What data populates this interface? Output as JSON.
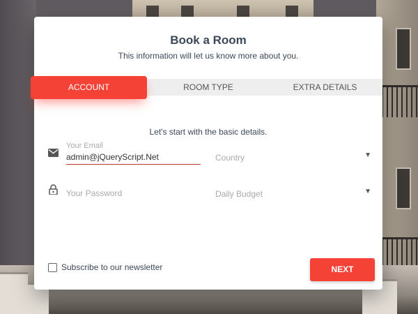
{
  "card": {
    "title": "Book a Room",
    "subtitle": "This information will let us know more about you.",
    "info": "Let's start with the basic details."
  },
  "tabs": [
    {
      "label": "ACCOUNT",
      "active": true
    },
    {
      "label": "ROOM TYPE",
      "active": false
    },
    {
      "label": "EXTRA DETAILS",
      "active": false
    }
  ],
  "form": {
    "email": {
      "label": "Your Email",
      "value": "admin@jQueryScript.Net",
      "icon": "envelope-icon"
    },
    "password": {
      "placeholder": "Your Password",
      "icon": "lock-icon"
    },
    "country": {
      "placeholder": "Country"
    },
    "budget": {
      "placeholder": "Daily Budget"
    }
  },
  "newsletter": {
    "label": "Subscribe to our newsletter",
    "checked": false
  },
  "buttons": {
    "next": "NEXT"
  },
  "colors": {
    "accent": "#f44336",
    "text": "#3c4858",
    "tab_bg": "#eeeeee"
  }
}
